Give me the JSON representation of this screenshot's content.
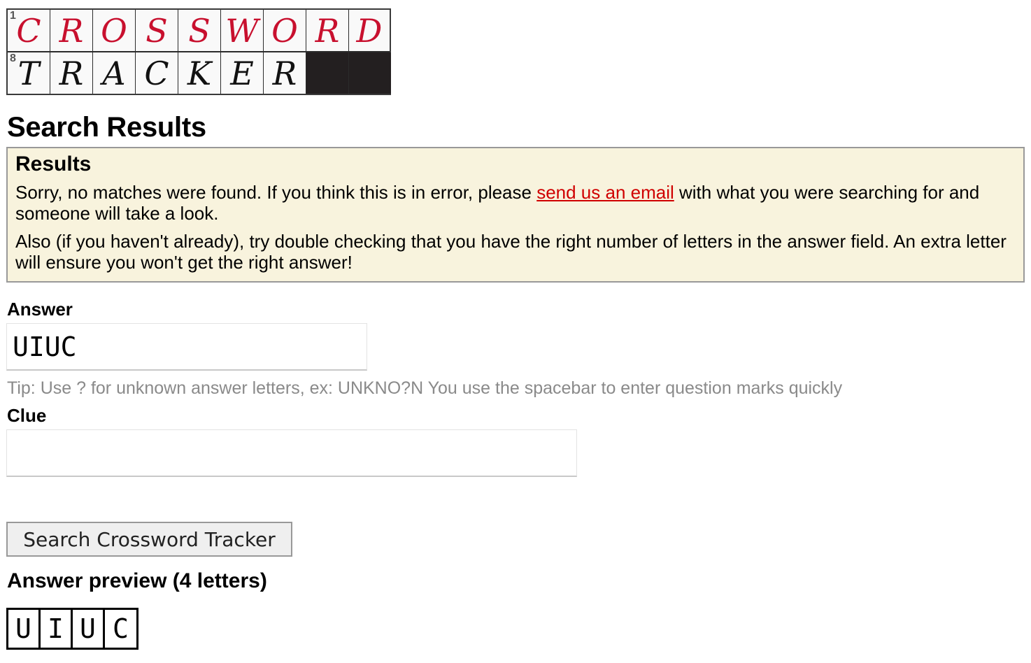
{
  "logo": {
    "row1": {
      "number": "1",
      "letters": [
        "C",
        "R",
        "O",
        "S",
        "S",
        "W",
        "O",
        "R",
        "D"
      ],
      "color": "#c8102e"
    },
    "row2": {
      "number": "8",
      "letters": [
        "T",
        "R",
        "A",
        "C",
        "K",
        "E",
        "R"
      ],
      "filled_cells": 2,
      "color": "#111111"
    }
  },
  "page_title": "Search Results",
  "results": {
    "heading": "Results",
    "message_before_link": "Sorry, no matches were found. If you think this is in error, please ",
    "link_text": "send us an email",
    "message_after_link": " with what you were searching for and someone will take a look.",
    "hint": "Also (if you haven't already), try double checking that you have the right number of letters in the answer field. An extra letter will ensure you won't get the right answer!",
    "link_color": "#d00000",
    "background_color": "#f8f3dd"
  },
  "form": {
    "answer_label": "Answer",
    "answer_value": "UIUC",
    "tip": "Tip: Use ? for unknown answer letters, ex: UNKNO?N You use the spacebar to enter question marks quickly",
    "clue_label": "Clue",
    "clue_value": "",
    "search_button": "Search Crossword Tracker"
  },
  "preview": {
    "title": "Answer preview (4 letters)",
    "letters": [
      "U",
      "I",
      "U",
      "C"
    ]
  }
}
